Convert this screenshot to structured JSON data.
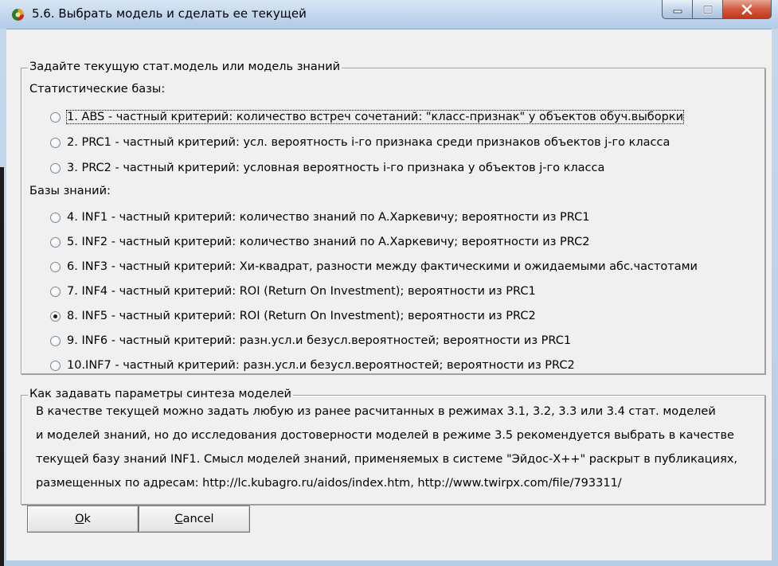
{
  "window": {
    "title": "5.6. Выбрать модель и сделать ее текущей"
  },
  "model_group": {
    "legend": "Задайте текущую стат.модель или модель знаний",
    "stat_label": "Статистические базы:",
    "knowledge_label": "Базы знаний:",
    "stat_options": [
      {
        "label": "1. ABS  - частный критерий: количество встреч сочетаний: \"класс-признак\" у объектов обуч.выборки",
        "checked": false
      },
      {
        "label": "2. PRC1 - частный критерий: усл. вероятность i-го признака среди признаков объектов j-го класса",
        "checked": false
      },
      {
        "label": "3. PRC2 - частный критерий: условная вероятность i-го признака у объектов j-го класса",
        "checked": false
      }
    ],
    "knowledge_options": [
      {
        "label": "4. INF1 - частный критерий: количество знаний по А.Харкевичу; вероятности из PRC1",
        "checked": false
      },
      {
        "label": "5. INF2 - частный критерий: количество знаний по А.Харкевичу; вероятности из PRC2",
        "checked": false
      },
      {
        "label": "6. INF3 - частный критерий: Хи-квадрат, разности между фактическими и ожидаемыми абс.частотами",
        "checked": false
      },
      {
        "label": "7. INF4 - частный критерий: ROI (Return On Investment); вероятности из PRC1",
        "checked": false
      },
      {
        "label": "8. INF5 - частный критерий: ROI (Return On Investment); вероятности из PRC2",
        "checked": true
      },
      {
        "label": "9. INF6 - частный критерий: разн.усл.и безусл.вероятностей; вероятности из PRC1",
        "checked": false
      },
      {
        "label": "10.INF7 - частный критерий: разн.усл.и безусл.вероятностей; вероятности из PRC2",
        "checked": false
      }
    ]
  },
  "help_group": {
    "legend": "Как задавать параметры синтеза моделей",
    "lines": [
      "В качестве текущей можно задать любую из ранее расчитанных в режимах 3.1, 3.2, 3.3 или 3.4 стат. моделей",
      "и моделей знаний, но до исследования достоверности моделей в режиме 3.5 рекомендуется выбрать в качестве",
      "текущей базу знаний INF1. Смысл моделей знаний, применяемых в системе \"Эйдос-Х++\" раскрыт в публикациях,",
      "размещенных по адресам: http://lc.kubagro.ru/aidos/index.htm, http://www.twirpx.com/file/793311/"
    ]
  },
  "buttons": {
    "ok": "Ok",
    "cancel": "Cancel"
  },
  "icons": {
    "app": "app-globe-icon",
    "minimize": "minimize-icon",
    "maximize": "maximize-icon",
    "close": "close-icon"
  },
  "colors": {
    "titlebar": "#c2d6ec",
    "close_button": "#c8452a",
    "client_background": "#f0f0f0"
  }
}
